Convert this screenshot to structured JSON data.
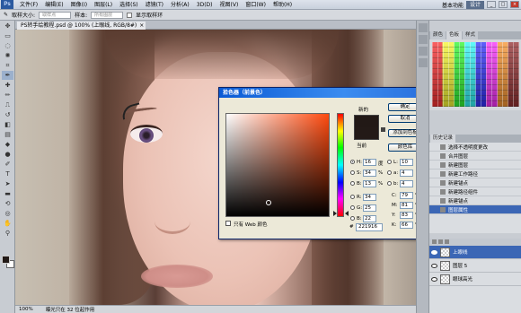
{
  "menubar": {
    "logo": "Ps",
    "items": [
      "文件(F)",
      "编辑(E)",
      "图像(I)",
      "图层(L)",
      "选择(S)",
      "滤镜(T)",
      "分析(A)",
      "3D(D)",
      "视图(V)",
      "窗口(W)",
      "帮助(H)"
    ],
    "workspace": "基本功能",
    "design_btn": "设计"
  },
  "options": {
    "sample_size_label": "取样大小:",
    "sample_size_value": "取样点",
    "sample_label": "样本:",
    "sample_value": "所有图层",
    "show_ring_label": "显示取样环"
  },
  "document": {
    "tab_title": "PS转手绘教程.psd @ 100% (上眼线, RGB/8#)",
    "status_zoom": "100%",
    "status_info": "曝光只在 32 位起作用"
  },
  "dialog": {
    "title": "拾色器（前景色）",
    "new_label": "新的",
    "current_label": "当前",
    "ok": "确定",
    "cancel": "取消",
    "add_to_swatches": "添加到色板",
    "color_libraries": "颜色库",
    "web_only": "只有 Web 颜色",
    "hsb": {
      "H": "16",
      "S": "34",
      "B": "13"
    },
    "hsb_units": {
      "H": "度",
      "S": "%",
      "B": "%"
    },
    "rgb": {
      "R": "34",
      "G": "25",
      "B": "22"
    },
    "lab": {
      "L": "10",
      "a": "4",
      "b": "4"
    },
    "cmyk": {
      "C": "79",
      "M": "81",
      "Y": "83",
      "K": "66"
    },
    "hex": "221916",
    "colors": {
      "new": "#221916",
      "current": "#231a17"
    }
  },
  "panels": {
    "swatch_tabs": [
      "颜色",
      "色板",
      "样式"
    ],
    "history_tab": "历史记录",
    "history_items": [
      "选择不透明度更改",
      "合并图层",
      "新建图层",
      "新建工作路径",
      "新建锚点",
      "新建路径组件",
      "新建锚点",
      "图层属性"
    ],
    "layer_items": [
      "上眼线",
      "图层 5",
      "眼球高光"
    ]
  }
}
